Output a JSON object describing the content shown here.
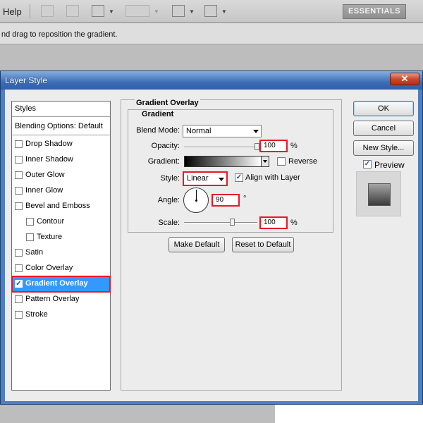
{
  "app": {
    "menu_help": "Help",
    "workspace_button": "ESSENTIALS",
    "status_hint": "nd drag to reposition the gradient."
  },
  "dialog": {
    "title": "Layer Style",
    "close_glyph": "✕",
    "styles_header": "Styles",
    "blending_options": "Blending Options: Default",
    "effects": [
      {
        "label": "Drop Shadow",
        "checked": false
      },
      {
        "label": "Inner Shadow",
        "checked": false
      },
      {
        "label": "Outer Glow",
        "checked": false
      },
      {
        "label": "Inner Glow",
        "checked": false
      },
      {
        "label": "Bevel and Emboss",
        "checked": false
      },
      {
        "label": "Contour",
        "checked": false
      },
      {
        "label": "Texture",
        "checked": false
      },
      {
        "label": "Satin",
        "checked": false
      },
      {
        "label": "Color Overlay",
        "checked": false
      },
      {
        "label": "Gradient Overlay",
        "checked": true
      },
      {
        "label": "Pattern Overlay",
        "checked": false
      },
      {
        "label": "Stroke",
        "checked": false
      }
    ],
    "panel": {
      "section_title": "Gradient Overlay",
      "group_title": "Gradient",
      "blend_mode_label": "Blend Mode:",
      "blend_mode_value": "Normal",
      "opacity_label": "Opacity:",
      "opacity_value": "100",
      "opacity_unit": "%",
      "gradient_label": "Gradient:",
      "gradient_colors": [
        "#000000",
        "#ffffff"
      ],
      "reverse_label": "Reverse",
      "reverse_checked": false,
      "style_label": "Style:",
      "style_value": "Linear",
      "align_label": "Align with Layer",
      "align_checked": true,
      "angle_label": "Angle:",
      "angle_value": "90",
      "angle_unit": "°",
      "scale_label": "Scale:",
      "scale_value": "100",
      "scale_unit": "%",
      "make_default": "Make Default",
      "reset_default": "Reset to Default"
    },
    "buttons": {
      "ok": "OK",
      "cancel": "Cancel",
      "new_style": "New Style...",
      "preview_label": "Preview",
      "preview_checked": true
    }
  }
}
